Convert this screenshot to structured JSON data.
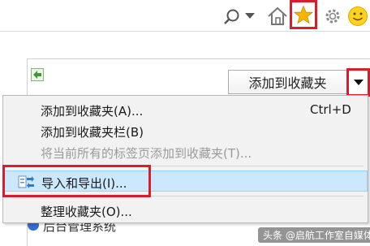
{
  "toolbar": {
    "search_icon": "search-icon",
    "dropdown_icon": "chevron-down-icon",
    "home_icon": "home-icon",
    "favorites_icon": "star-icon",
    "tools_icon": "gear-icon",
    "feedback_icon": "smiley-icon"
  },
  "panel": {
    "add_to_favorites_label": "添加到收藏夹"
  },
  "menu": {
    "items": [
      {
        "label": "添加到收藏夹(A)...",
        "shortcut": "Ctrl+D",
        "enabled": true
      },
      {
        "label": "添加到收藏夹栏(B)",
        "shortcut": "",
        "enabled": true
      },
      {
        "label": "将当前所有的标签页添加到收藏夹(T)...",
        "shortcut": "",
        "enabled": false
      },
      {
        "label": "导入和导出(I)...",
        "shortcut": "",
        "enabled": true,
        "highlighted": true
      },
      {
        "label": "整理收藏夹(O)...",
        "shortcut": "",
        "enabled": true
      }
    ]
  },
  "background": {
    "list_item_partial": "后台管理系统"
  },
  "watermark": "头条 @启航工作室自媒体",
  "colors": {
    "annotation_red": "#d81e2a",
    "star_yellow": "#f5b800",
    "highlight_bg": "#cce8ff"
  }
}
